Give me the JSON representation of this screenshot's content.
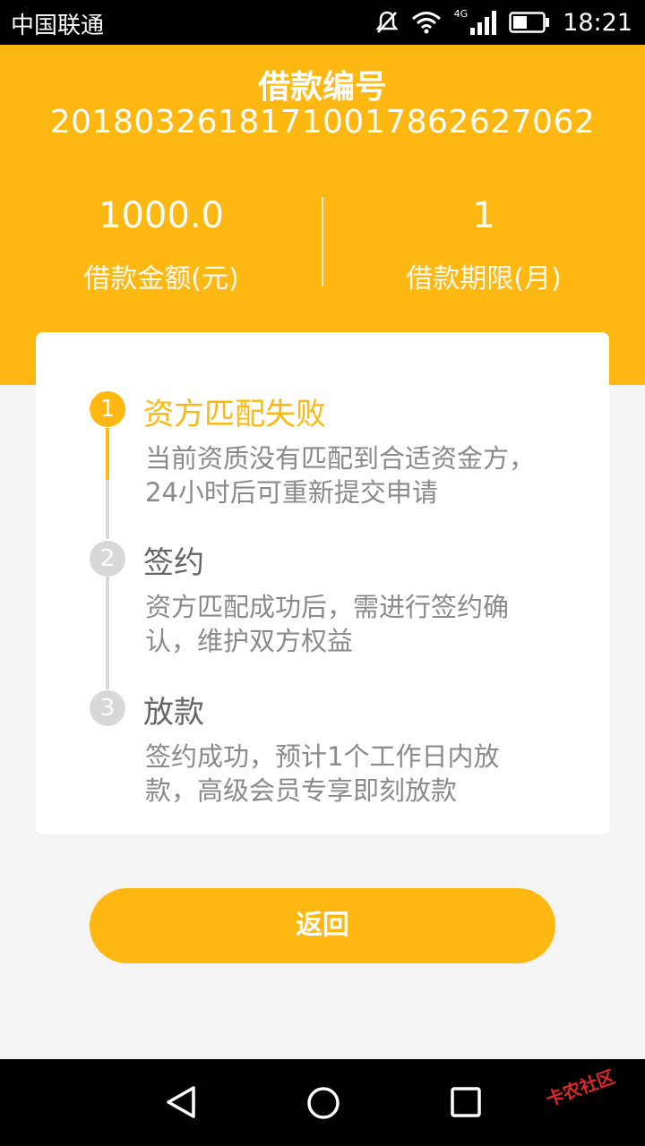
{
  "status_bar": {
    "carrier": "中国联通",
    "network": "4G",
    "time": "18:21"
  },
  "header": {
    "loan_no_label": "借款编号",
    "loan_no": "20180326181710017862627062",
    "amount_value": "1000.0",
    "amount_label": "借款金额(元)",
    "term_value": "1",
    "term_label": "借款期限(月)"
  },
  "steps": [
    {
      "index": "1",
      "title": "资方匹配失败",
      "desc": "当前资质没有匹配到合适资金方，24小时后可重新提交申请",
      "status": "failed"
    },
    {
      "index": "2",
      "title": "签约",
      "desc": "资方匹配成功后，需进行签约确认，维护双方权益",
      "status": "pending"
    },
    {
      "index": "3",
      "title": "放款",
      "desc": "签约成功，预计1个工作日内放款，高级会员专享即刻放款",
      "status": "pending"
    }
  ],
  "return_label": "返回",
  "watermark_text": "卡农社区",
  "colors": {
    "accent": "#ffb812",
    "inactive": "#d8d8d8",
    "text": "#666666",
    "subtext": "#8a8a8a"
  },
  "icons": {
    "mute": "mute-icon",
    "wifi": "wifi-icon",
    "signal": "signal-icon",
    "battery": "battery-icon",
    "back": "back-triangle-icon",
    "home": "home-circle-icon",
    "recent": "recent-square-icon"
  }
}
